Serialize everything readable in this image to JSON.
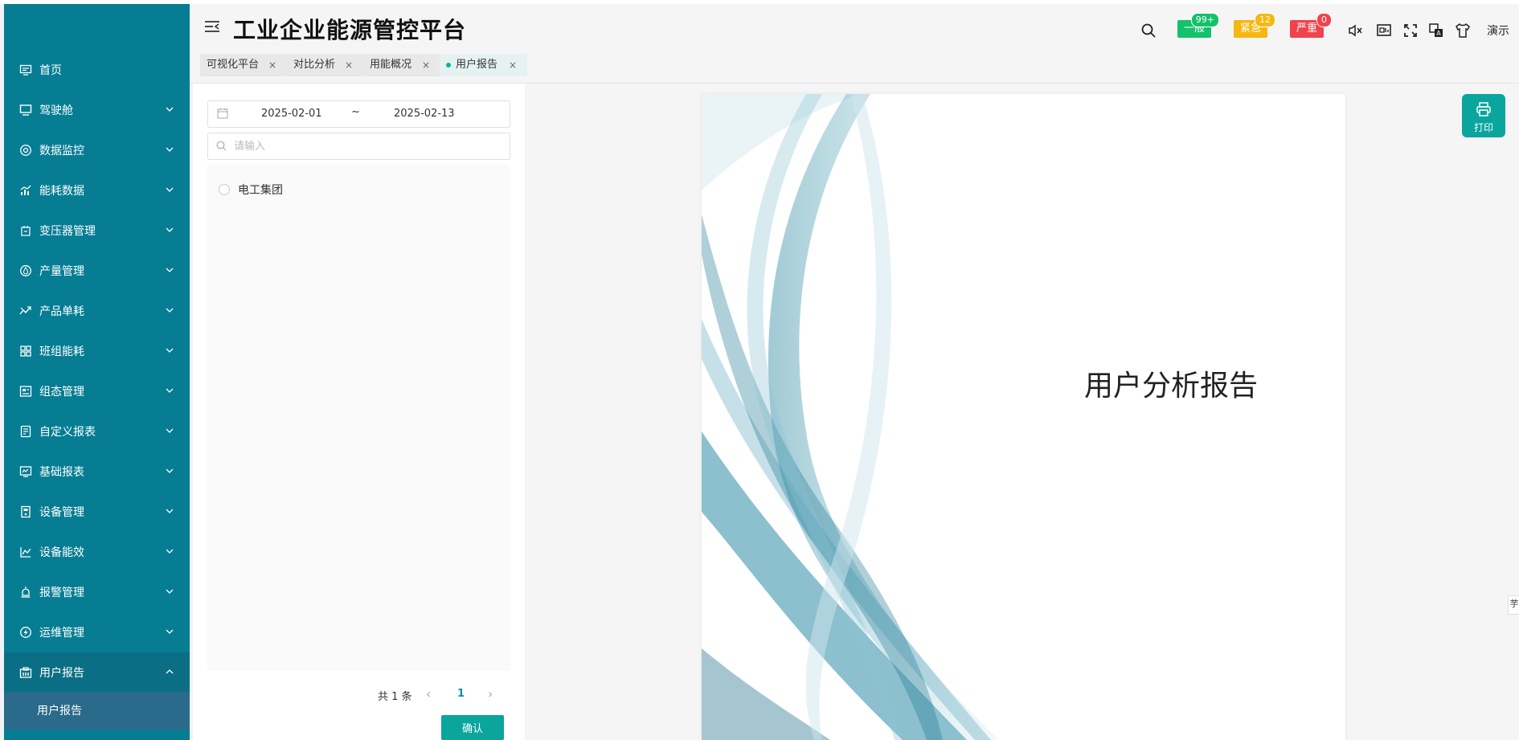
{
  "app": {
    "title": "工业企业能源管控平台"
  },
  "colors": {
    "sidebar": "#067d93",
    "accent": "#0aa59c",
    "general": "#13c26b",
    "urgent": "#f5b80f",
    "severe": "#f0434d"
  },
  "sidebar": {
    "items": [
      {
        "label": "首页",
        "icon": "home-icon"
      },
      {
        "label": "驾驶舱",
        "icon": "monitor-icon"
      },
      {
        "label": "数据监控",
        "icon": "monitoring-icon"
      },
      {
        "label": "能耗数据",
        "icon": "chart-icon"
      },
      {
        "label": "变压器管理",
        "icon": "transformer-icon"
      },
      {
        "label": "产量管理",
        "icon": "droplet-icon"
      },
      {
        "label": "产品单耗",
        "icon": "trend-icon"
      },
      {
        "label": "班组能耗",
        "icon": "grid-icon"
      },
      {
        "label": "组态管理",
        "icon": "dashboard-icon"
      },
      {
        "label": "自定义报表",
        "icon": "document-icon"
      },
      {
        "label": "基础报表",
        "icon": "report-icon"
      },
      {
        "label": "设备管理",
        "icon": "device-icon"
      },
      {
        "label": "设备能效",
        "icon": "line-chart-icon"
      },
      {
        "label": "报警管理",
        "icon": "alarm-icon"
      },
      {
        "label": "运维管理",
        "icon": "lightning-icon"
      },
      {
        "label": "用户报告",
        "icon": "building-icon"
      }
    ],
    "submenu": {
      "label": "用户报告"
    }
  },
  "header": {
    "alarms": [
      {
        "label": "一般",
        "count": "99+",
        "color": "#13c26b"
      },
      {
        "label": "紧急",
        "count": "12",
        "color": "#f5b80f"
      },
      {
        "label": "严重",
        "count": "0",
        "color": "#f0434d"
      }
    ],
    "user": "演示",
    "tabs": [
      {
        "label": "可视化平台"
      },
      {
        "label": "对比分析"
      },
      {
        "label": "用能概况"
      },
      {
        "label": "用户报告"
      }
    ],
    "tab_close": "×"
  },
  "filter": {
    "start_date": "2025-02-01",
    "separator": "~",
    "end_date": "2025-02-13",
    "search_placeholder": "请输入",
    "tree": [
      {
        "label": "电工集团"
      }
    ],
    "pagination": {
      "total": "共 1 条",
      "prev": "‹",
      "current": "1",
      "next": "›"
    },
    "confirm": "确认"
  },
  "report": {
    "title": "用户分析报告",
    "print_label": "打印"
  },
  "side_tag": "芋"
}
